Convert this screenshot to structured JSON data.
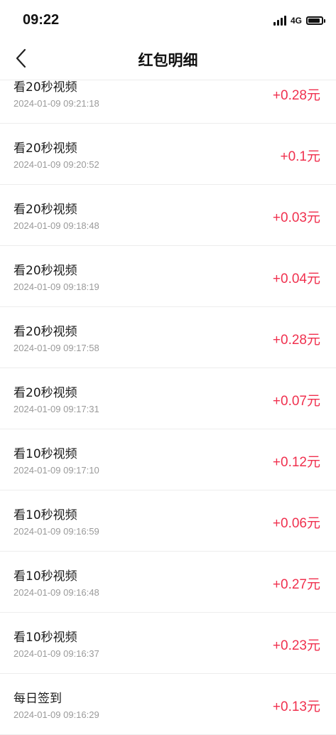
{
  "status_bar": {
    "time": "09:22",
    "network": "4G",
    "signal_icon": "signal-bars-icon",
    "battery_icon": "battery-icon"
  },
  "nav": {
    "title": "红包明细",
    "back_icon": "chevron-left-icon"
  },
  "colors": {
    "amount": "#f0304e",
    "title_text": "#1a1a1a",
    "time_text": "#9a9a9a",
    "divider": "#ededed"
  },
  "records": [
    {
      "title": "看20秒视频",
      "time": "2024-01-09 09:21:18",
      "amount": "+0.28元"
    },
    {
      "title": "看20秒视频",
      "time": "2024-01-09 09:20:52",
      "amount": "+0.1元"
    },
    {
      "title": "看20秒视频",
      "time": "2024-01-09 09:18:48",
      "amount": "+0.03元"
    },
    {
      "title": "看20秒视频",
      "time": "2024-01-09 09:18:19",
      "amount": "+0.04元"
    },
    {
      "title": "看20秒视频",
      "time": "2024-01-09 09:17:58",
      "amount": "+0.28元"
    },
    {
      "title": "看20秒视频",
      "time": "2024-01-09 09:17:31",
      "amount": "+0.07元"
    },
    {
      "title": "看10秒视频",
      "time": "2024-01-09 09:17:10",
      "amount": "+0.12元"
    },
    {
      "title": "看10秒视频",
      "time": "2024-01-09 09:16:59",
      "amount": "+0.06元"
    },
    {
      "title": "看10秒视频",
      "time": "2024-01-09 09:16:48",
      "amount": "+0.27元"
    },
    {
      "title": "看10秒视频",
      "time": "2024-01-09 09:16:37",
      "amount": "+0.23元"
    },
    {
      "title": "每日签到",
      "time": "2024-01-09 09:16:29",
      "amount": "+0.13元"
    }
  ]
}
